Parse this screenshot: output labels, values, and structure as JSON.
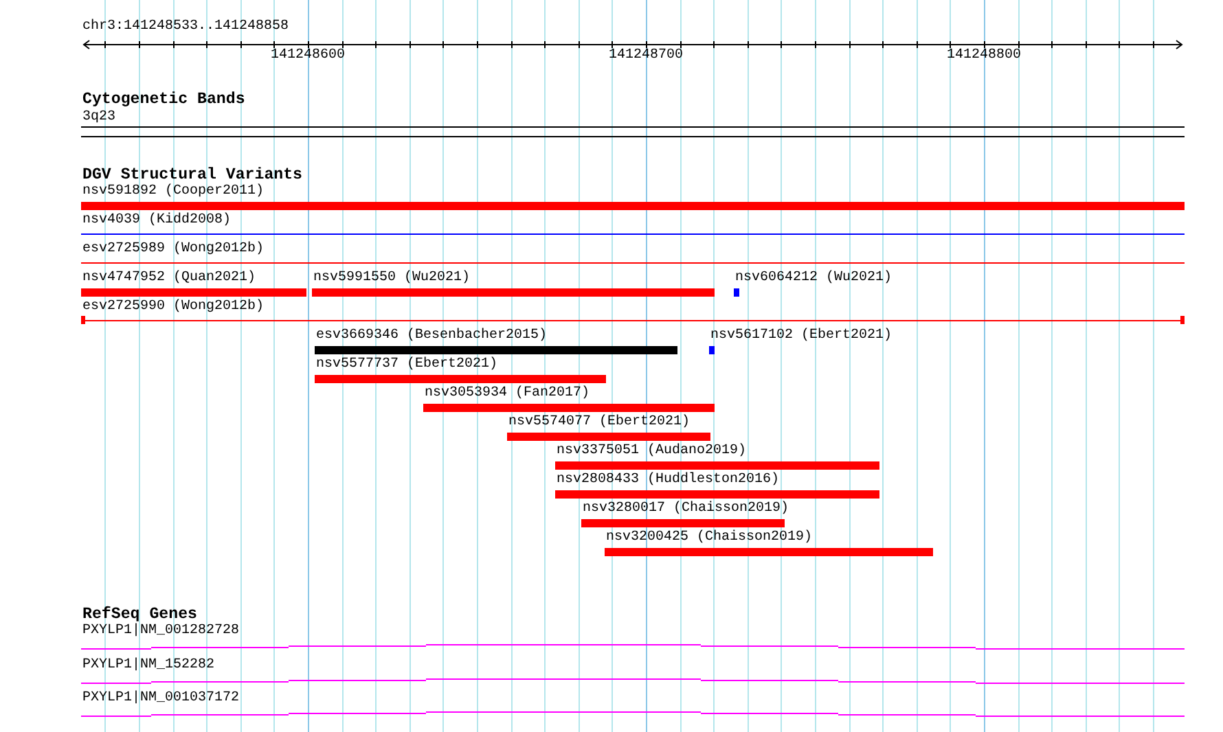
{
  "ruler": {
    "location": "chr3:141248533..141248858",
    "tick_labels": [
      "141248600",
      "141248700",
      "141248800"
    ]
  },
  "cytogenetic_bands": {
    "title": "Cytogenetic Bands",
    "features": [
      {
        "label": "3q23"
      }
    ]
  },
  "structural_variants": {
    "title": "DGV Structural Variants",
    "features": [
      {
        "label": "nsv591892 (Cooper2011)",
        "kind": "bar",
        "color": "#ff0000"
      },
      {
        "label": "nsv4039 (Kidd2008)",
        "kind": "line",
        "color": "#0000ff"
      },
      {
        "label": "esv2725989 (Wong2012b)",
        "kind": "line",
        "color": "#ff0000"
      },
      {
        "label": "nsv4747952 (Quan2021)",
        "kind": "bar",
        "color": "#ff0000"
      },
      {
        "label": "nsv5991550 (Wu2021)",
        "kind": "bar",
        "color": "#ff0000"
      },
      {
        "label": "nsv6064212 (Wu2021)",
        "kind": "point",
        "color": "#0000ff"
      },
      {
        "label": "esv2725990 (Wong2012b)",
        "kind": "capped-line",
        "color": "#ff0000"
      },
      {
        "label": "esv3669346 (Besenbacher2015)",
        "kind": "bar",
        "color": "#000000"
      },
      {
        "label": "nsv5617102 (Ebert2021)",
        "kind": "point",
        "color": "#0000ff"
      },
      {
        "label": "nsv5577737 (Ebert2021)",
        "kind": "bar",
        "color": "#ff0000"
      },
      {
        "label": "nsv3053934 (Fan2017)",
        "kind": "bar",
        "color": "#ff0000"
      },
      {
        "label": "nsv5574077 (Ebert2021)",
        "kind": "bar",
        "color": "#ff0000"
      },
      {
        "label": "nsv3375051 (Audano2019)",
        "kind": "bar",
        "color": "#ff0000"
      },
      {
        "label": "nsv2808433 (Huddleston2016)",
        "kind": "bar",
        "color": "#ff0000"
      },
      {
        "label": "nsv3280017 (Chaisson2019)",
        "kind": "bar",
        "color": "#ff0000"
      },
      {
        "label": "nsv3200425 (Chaisson2019)",
        "kind": "bar",
        "color": "#ff0000"
      }
    ]
  },
  "refseq_genes": {
    "title": "RefSeq Genes",
    "features": [
      {
        "label": "PXYLP1|NM_001282728"
      },
      {
        "label": "PXYLP1|NM_152282"
      },
      {
        "label": "PXYLP1|NM_001037172"
      }
    ]
  }
}
